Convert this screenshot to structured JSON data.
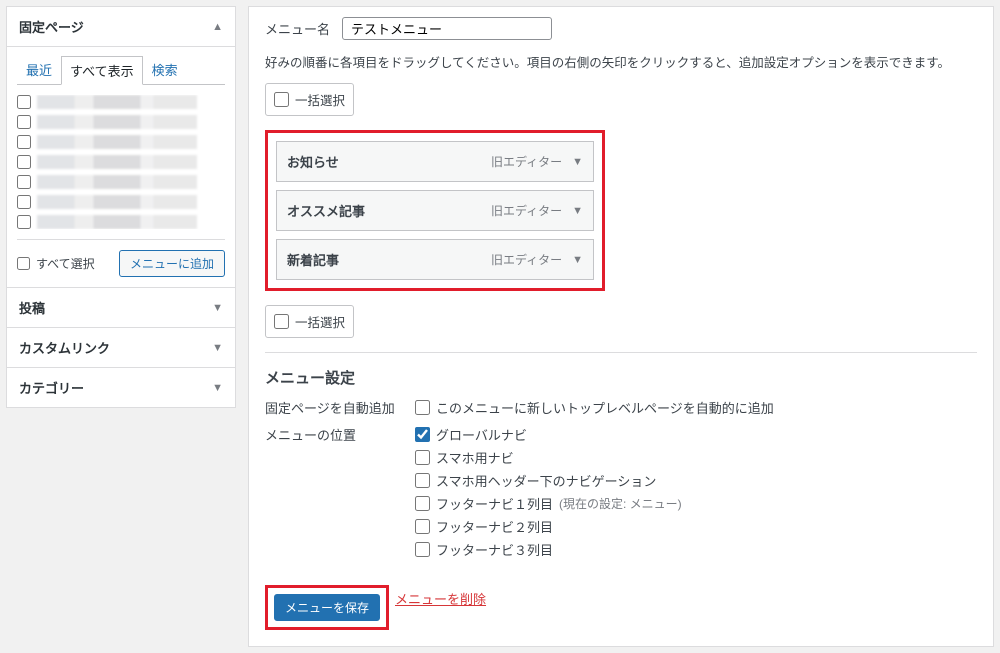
{
  "sidebar": {
    "panels": {
      "pages": {
        "title": "固定ページ",
        "tabs": {
          "recent": "最近",
          "all": "すべて表示",
          "search": "検索"
        },
        "select_all": "すべて選択",
        "add_button": "メニューに追加"
      },
      "posts": {
        "title": "投稿"
      },
      "custom": {
        "title": "カスタムリンク"
      },
      "category": {
        "title": "カテゴリー"
      }
    }
  },
  "main": {
    "menu_name_label": "メニュー名",
    "menu_name_value": "テストメニュー",
    "instruction": "好みの順番に各項目をドラッグしてください。項目の右側の矢印をクリックすると、追加設定オプションを表示できます。",
    "bulk_select": "一括選択",
    "items": [
      {
        "title": "お知らせ",
        "type": "旧エディター"
      },
      {
        "title": "オススメ記事",
        "type": "旧エディター"
      },
      {
        "title": "新着記事",
        "type": "旧エディター"
      }
    ],
    "settings": {
      "heading": "メニュー設定",
      "auto_add_label": "固定ページを自動追加",
      "auto_add_option": "このメニューに新しいトップレベルページを自動的に追加",
      "location_label": "メニューの位置",
      "locations": [
        {
          "label": "グローバルナビ",
          "checked": true
        },
        {
          "label": "スマホ用ナビ",
          "checked": false
        },
        {
          "label": "スマホ用ヘッダー下のナビゲーション",
          "checked": false
        },
        {
          "label": "フッターナビ１列目",
          "checked": false,
          "note": "(現在の設定: メニュー)"
        },
        {
          "label": "フッターナビ２列目",
          "checked": false
        },
        {
          "label": "フッターナビ３列目",
          "checked": false
        }
      ]
    },
    "save_button": "メニューを保存",
    "delete_link": "メニューを削除"
  }
}
